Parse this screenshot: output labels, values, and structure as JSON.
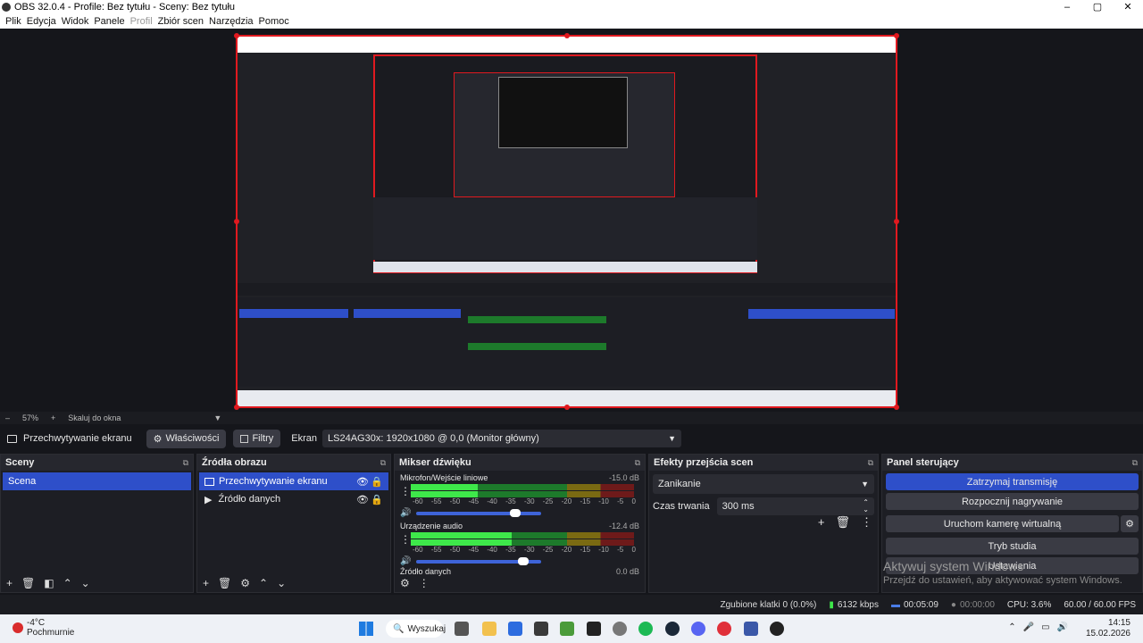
{
  "window": {
    "title": "OBS 32.0.4 - Profile: Bez tytułu - Sceny: Bez tytułu",
    "controls": [
      "–",
      "▢",
      "✕"
    ]
  },
  "menu": [
    "Plik",
    "Edycja",
    "Widok",
    "Panele",
    "Profil",
    "Zbiór scen",
    "Narzędzia",
    "Pomoc"
  ],
  "zoom": {
    "value": "57%",
    "minus": "–",
    "plus": "+",
    "mode": "Skaluj do okna"
  },
  "source_context": {
    "source_name": "Przechwytywanie ekranu",
    "properties": "Właściwości",
    "filters": "Filtry",
    "display_label": "Ekran",
    "display_value": "LS24AG30x: 1920x1080 @ 0,0 (Monitor główny)"
  },
  "docks": {
    "scenes": {
      "title": "Sceny",
      "items": [
        "Scena"
      ]
    },
    "sources": {
      "title": "Źródła obrazu",
      "items": [
        "Przechwytywanie ekranu",
        "Źródło danych"
      ]
    },
    "mixer": {
      "title": "Mikser dźwięku",
      "ticks": [
        "-60",
        "-55",
        "-50",
        "-45",
        "-40",
        "-35",
        "-30",
        "-25",
        "-20",
        "-15",
        "-10",
        "-5",
        "0"
      ],
      "channels": [
        {
          "name": "Mikrofon/Wejście liniowe",
          "db": "-15.0 dB",
          "level": 0.3,
          "volume": 0.83
        },
        {
          "name": "Urządzenie audio",
          "db": "-12.4 dB",
          "level": 0.45,
          "volume": 0.9
        },
        {
          "name": "Źródło danych",
          "db": "0.0 dB"
        }
      ]
    },
    "transitions": {
      "title": "Efekty przejścia scen",
      "selected": "Zanikanie",
      "duration_label": "Czas trwania",
      "duration_value": "300 ms"
    },
    "controls": {
      "title": "Panel sterujący",
      "buttons": [
        "Zatrzymaj transmisję",
        "Rozpocznij nagrywanie",
        "Uruchom kamerę wirtualną",
        "Tryb studia",
        "Ustawienia"
      ]
    }
  },
  "watermark": {
    "title": "Aktywuj system Windows",
    "subtitle": "Przejdź do ustawień, aby aktywować system Windows."
  },
  "status": {
    "dropped": "Zgubione klatki 0 (0.0%)",
    "bitrate": "6132 kbps",
    "stream_time": "00:05:09",
    "rec_time": "00:00:00",
    "cpu": "CPU: 3.6%",
    "fps": "60.00 / 60.00 FPS"
  },
  "taskbar": {
    "weather_temp": "-4°C",
    "weather_desc": "Pochmurnie",
    "search": "Wyszukaj",
    "time": "14:15",
    "date": "15.02.2026"
  }
}
